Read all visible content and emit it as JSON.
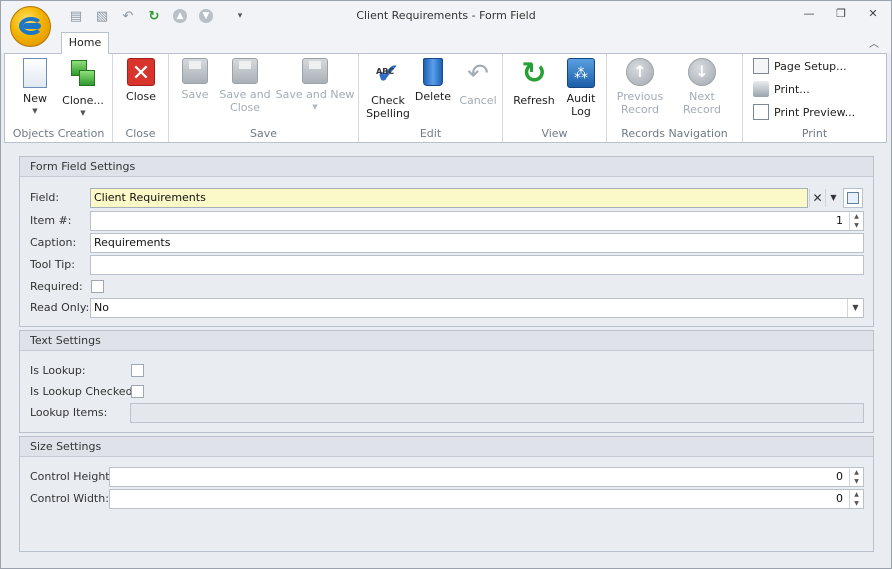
{
  "window": {
    "title": "Client Requirements - Form Field",
    "controls": [
      "minimize",
      "restore",
      "close"
    ]
  },
  "qat": {
    "items": [
      "save-icon",
      "save-close-icon",
      "undo-icon",
      "refresh-icon",
      "up-icon",
      "down-icon",
      "customize-icon"
    ]
  },
  "tabs": [
    {
      "label": "Home"
    }
  ],
  "ribbon": {
    "groups": {
      "objects_creation": "Objects Creation",
      "close": "Close",
      "save": "Save",
      "edit": "Edit",
      "view": "View",
      "records_navigation": "Records Navigation",
      "print": "Print"
    },
    "buttons": {
      "new": "New",
      "clone": "Clone...",
      "close": "Close",
      "save": "Save",
      "save_and_close_1": "Save and",
      "save_and_close_2": "Close",
      "save_and_new": "Save and New",
      "check_spelling_1": "Check",
      "check_spelling_2": "Spelling",
      "delete": "Delete",
      "cancel": "Cancel",
      "refresh": "Refresh",
      "audit_log_1": "Audit",
      "audit_log_2": "Log",
      "previous_record_1": "Previous",
      "previous_record_2": "Record",
      "next_record": "Next Record",
      "page_setup": "Page Setup...",
      "print": "Print...",
      "print_preview": "Print Preview..."
    }
  },
  "form_field_settings": {
    "header": "Form Field Settings",
    "field_label": "Field:",
    "field_value": "Client Requirements",
    "item_label": "Item #:",
    "item_value": "1",
    "caption_label": "Caption:",
    "caption_value": "Requirements",
    "tooltip_label": "Tool Tip:",
    "tooltip_value": "",
    "required_label": "Required:",
    "required_checked": false,
    "readonly_label": "Read Only:",
    "readonly_value": "No"
  },
  "text_settings": {
    "header": "Text Settings",
    "is_lookup_label": "Is Lookup:",
    "is_lookup_checked_label": "Is Lookup Checked:",
    "lookup_items_label": "Lookup Items:",
    "lookup_items_value": ""
  },
  "size_settings": {
    "header": "Size Settings",
    "control_height_label": "Control Height:",
    "control_height_value": "0",
    "control_width_label": "Control Width:",
    "control_width_value": "0"
  }
}
